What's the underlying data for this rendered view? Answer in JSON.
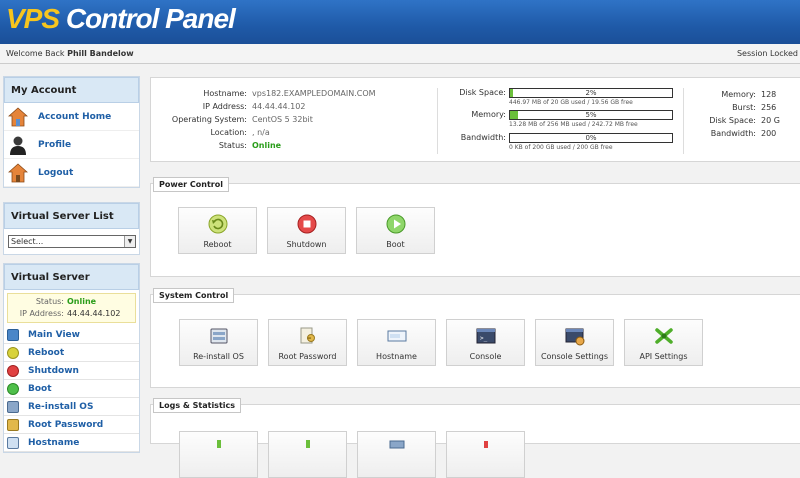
{
  "header": {
    "logo_vps": "VPS",
    "logo_rest": "Control Panel"
  },
  "welcome_bar": {
    "welcome_prefix": "Welcome Back",
    "user_name": "Phill Bandelow",
    "session": "Session Locked"
  },
  "sidebar": {
    "my_account": {
      "title": "My Account",
      "items": [
        "Account Home",
        "Profile",
        "Logout"
      ]
    },
    "server_list": {
      "title": "Virtual Server List",
      "selected": "Select..."
    },
    "virtual_server": {
      "title": "Virtual Server",
      "status_label": "Status:",
      "status_value": "Online",
      "ip_label": "IP Address:",
      "ip_value": "44.44.44.102",
      "items": [
        "Main View",
        "Reboot",
        "Shutdown",
        "Boot",
        "Re-install OS",
        "Root Password",
        "Hostname"
      ]
    }
  },
  "info": {
    "hostname_label": "Hostname:",
    "hostname": "vps182.EXAMPLEDOMAIN.COM",
    "ip_label": "IP Address:",
    "ip": "44.44.44.102",
    "os_label": "Operating System:",
    "os": "CentOS 5 32bit",
    "location_label": "Location:",
    "location": ", n/a",
    "status_label": "Status:",
    "status": "Online",
    "usage": [
      {
        "label": "Disk Space:",
        "percent": 2,
        "pct_text": "2%",
        "sub": "446.97 MB of 20 GB used / 19.56 GB free"
      },
      {
        "label": "Memory:",
        "percent": 5,
        "pct_text": "5%",
        "sub": "13.28 MB of 256 MB used / 242.72 MB free"
      },
      {
        "label": "Bandwidth:",
        "percent": 0,
        "pct_text": "0%",
        "sub": "0 KB of 200 GB used / 200 GB free"
      }
    ],
    "resources": [
      {
        "label": "Memory:",
        "value": "128"
      },
      {
        "label": "Burst:",
        "value": "256"
      },
      {
        "label": "Disk Space:",
        "value": "20 G"
      },
      {
        "label": "Bandwidth:",
        "value": "200"
      }
    ]
  },
  "power_control": {
    "title": "Power Control",
    "tiles": [
      "Reboot",
      "Shutdown",
      "Boot"
    ]
  },
  "system_control": {
    "title": "System Control",
    "tiles": [
      "Re-install OS",
      "Root Password",
      "Hostname",
      "Console",
      "Console Settings",
      "API Settings"
    ]
  },
  "logs": {
    "title": "Logs & Statistics"
  },
  "colors": {
    "header_blue": "#1f5aa8",
    "logo_yellow": "#f7c51e",
    "online_green": "#2a9d1a",
    "link_blue": "#1f5fa6"
  }
}
